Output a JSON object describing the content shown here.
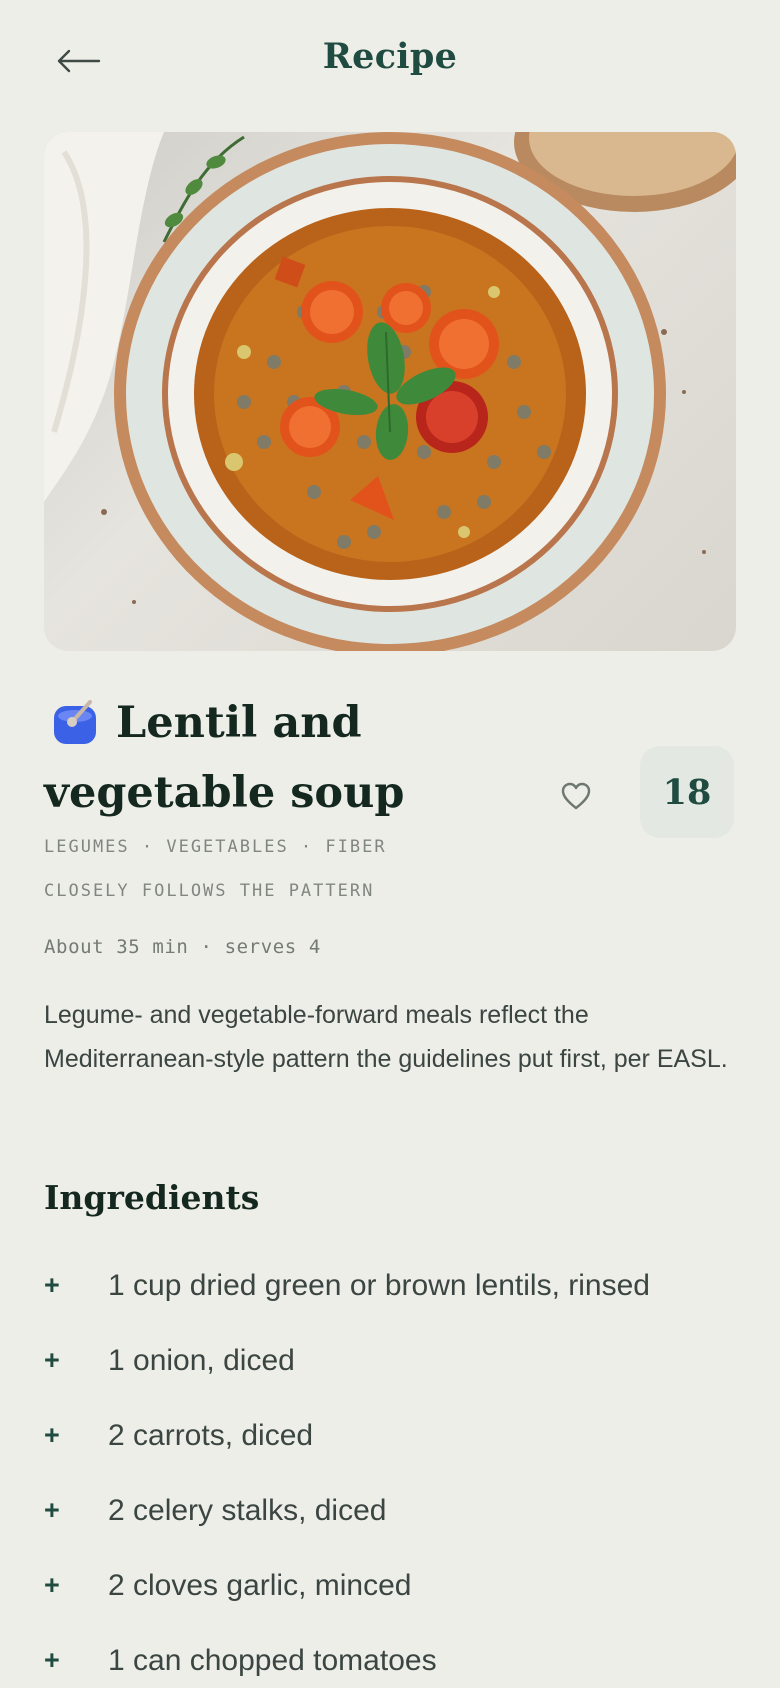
{
  "header": {
    "title": "Recipe",
    "back_icon": "arrow-left-icon"
  },
  "hero": {
    "image": "lentil-soup-photo"
  },
  "recipe": {
    "icon": "soup-bowl-icon",
    "title": "Lentil and vegetable soup",
    "favorite_icon": "heart-outline-icon",
    "score": "18",
    "tags": "LEGUMES · VEGETABLES · FIBER",
    "pattern_note": "CLOSELY FOLLOWS THE PATTERN",
    "meta": "About 35 min · serves 4",
    "description": "Legume- and vegetable-forward meals reflect the Mediterranean-style pattern the guidelines put first, per EASL."
  },
  "ingredients": {
    "title": "Ingredients",
    "bullet": "+",
    "items": [
      "1 cup dried green or brown lentils, rinsed",
      "1 onion, diced",
      "2 carrots, diced",
      "2 celery stalks, diced",
      "2 cloves garlic, minced",
      "1 can chopped tomatoes"
    ]
  },
  "colors": {
    "background": "#eeeee9",
    "accent": "#1f4b40",
    "badge_bg": "#e4e8e2",
    "text": "#142820",
    "muted": "#818680"
  }
}
